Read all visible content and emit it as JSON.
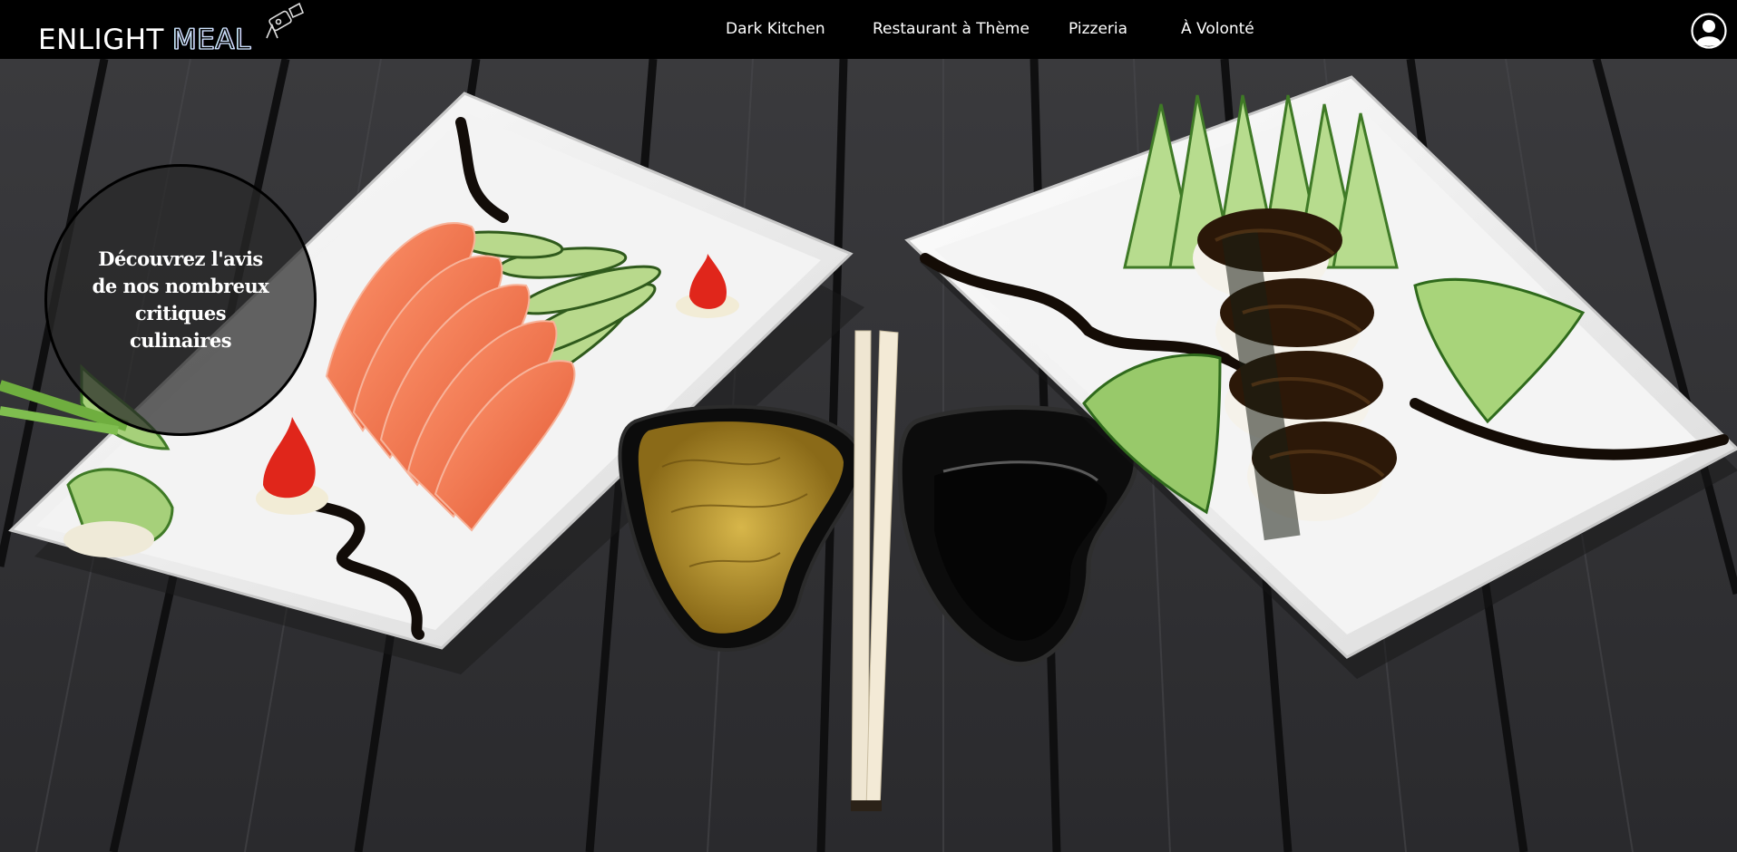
{
  "header": {
    "logo": {
      "part1": "ENLIGHT",
      "part2": "MEAL"
    },
    "nav": [
      {
        "label": "Dark Kitchen"
      },
      {
        "label": "Restaurant à Thème"
      },
      {
        "label": "Pizzeria"
      },
      {
        "label": "À Volonté"
      }
    ],
    "icons": {
      "logo_icon": "spotlight-icon",
      "account": "user-avatar-icon"
    }
  },
  "hero": {
    "image": "sushi-sashimi-plates-on-dark-wood-table",
    "review_cta": "Découvrez l'avis de nos nombreux critiques culinaires"
  },
  "colors": {
    "header_bg": "#000000",
    "nav_text": "#ffffff",
    "cta_bg": "#2a2a2a"
  }
}
